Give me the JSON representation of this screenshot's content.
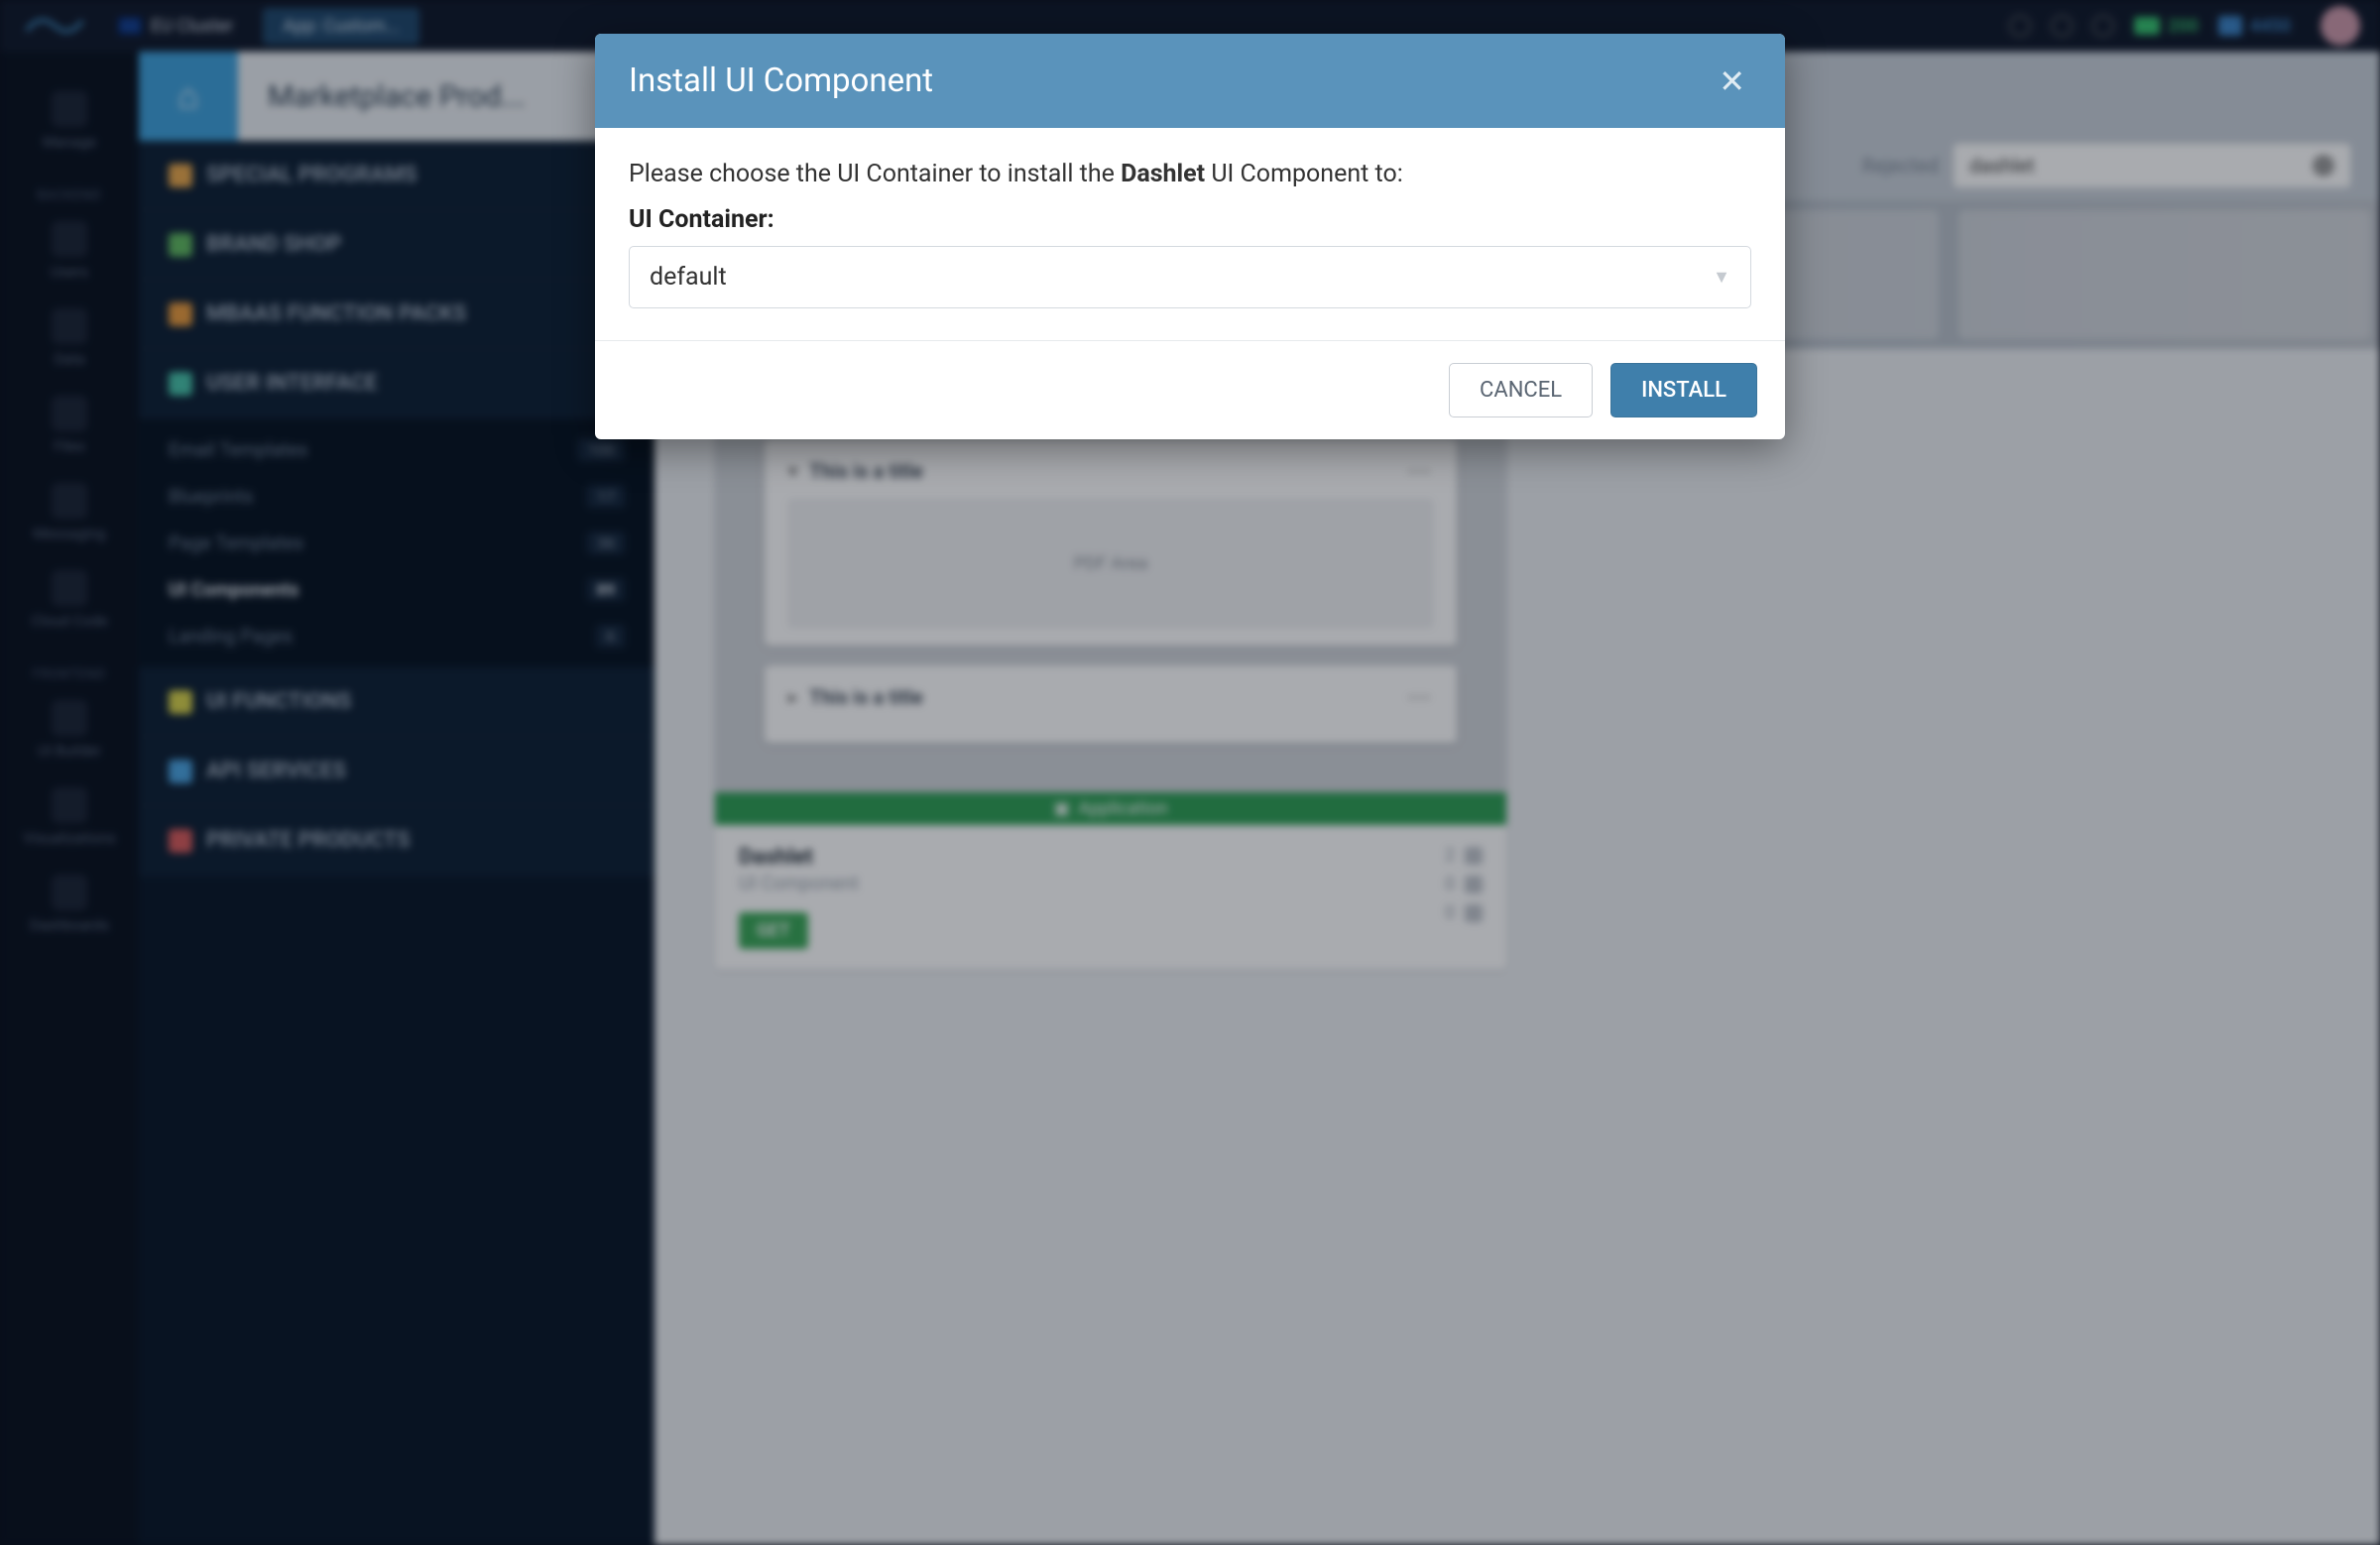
{
  "topbar": {
    "cluster_label": "EU Cluster",
    "app_tab_label": "App: Custom...",
    "credits_green": "200",
    "credits_blue": "4450"
  },
  "nav_rail": {
    "items_top": [
      {
        "label": "Manage"
      }
    ],
    "backend_header": "BACKEND",
    "items_backend": [
      {
        "label": "Users"
      },
      {
        "label": "Data"
      },
      {
        "label": "Files"
      },
      {
        "label": "Messaging"
      },
      {
        "label": "Cloud Code"
      }
    ],
    "frontend_header": "FRONTEND",
    "items_frontend": [
      {
        "label": "UI Builder"
      },
      {
        "label": "Visualizations"
      },
      {
        "label": "Dashboards"
      }
    ]
  },
  "sidepanel": {
    "page_title": "Marketplace Prod...",
    "sections": {
      "special_programs": "SPECIAL PROGRAMS",
      "brand_shop": "BRAND SHOP",
      "mbaas_packs": "MBAAS FUNCTION PACKS",
      "user_interface": "USER INTERFACE",
      "ui_functions": "UI FUNCTIONS",
      "api_services": "API SERVICES",
      "private_products": "PRIVATE PRODUCTS"
    },
    "ui_sub_items": [
      {
        "label": "Email Templates",
        "count": "100"
      },
      {
        "label": "Blueprints",
        "count": "17"
      },
      {
        "label": "Page Templates",
        "count": "36"
      },
      {
        "label": "UI Components",
        "count": "89",
        "active": true
      },
      {
        "label": "Landing Pages",
        "count": "6"
      }
    ]
  },
  "filters": {
    "rejected": "Rejected",
    "search_value": "dashlet"
  },
  "card": {
    "preview_title": "This is a title",
    "preview_body": "PDF Area",
    "preview_title2": "This is a title",
    "app_strip": "Application",
    "title": "Dashlet",
    "subtitle": "UI Component",
    "get_label": "GET",
    "stats": {
      "downloads": "2",
      "comments": "0",
      "stars": "0"
    }
  },
  "modal": {
    "title": "Install UI Component",
    "desc_prefix": "Please choose the UI Container to install the ",
    "desc_bold": "Dashlet",
    "desc_suffix": " UI Component to:",
    "field_label": "UI Container:",
    "select_value": "default",
    "cancel_label": "CANCEL",
    "install_label": "INSTALL"
  }
}
